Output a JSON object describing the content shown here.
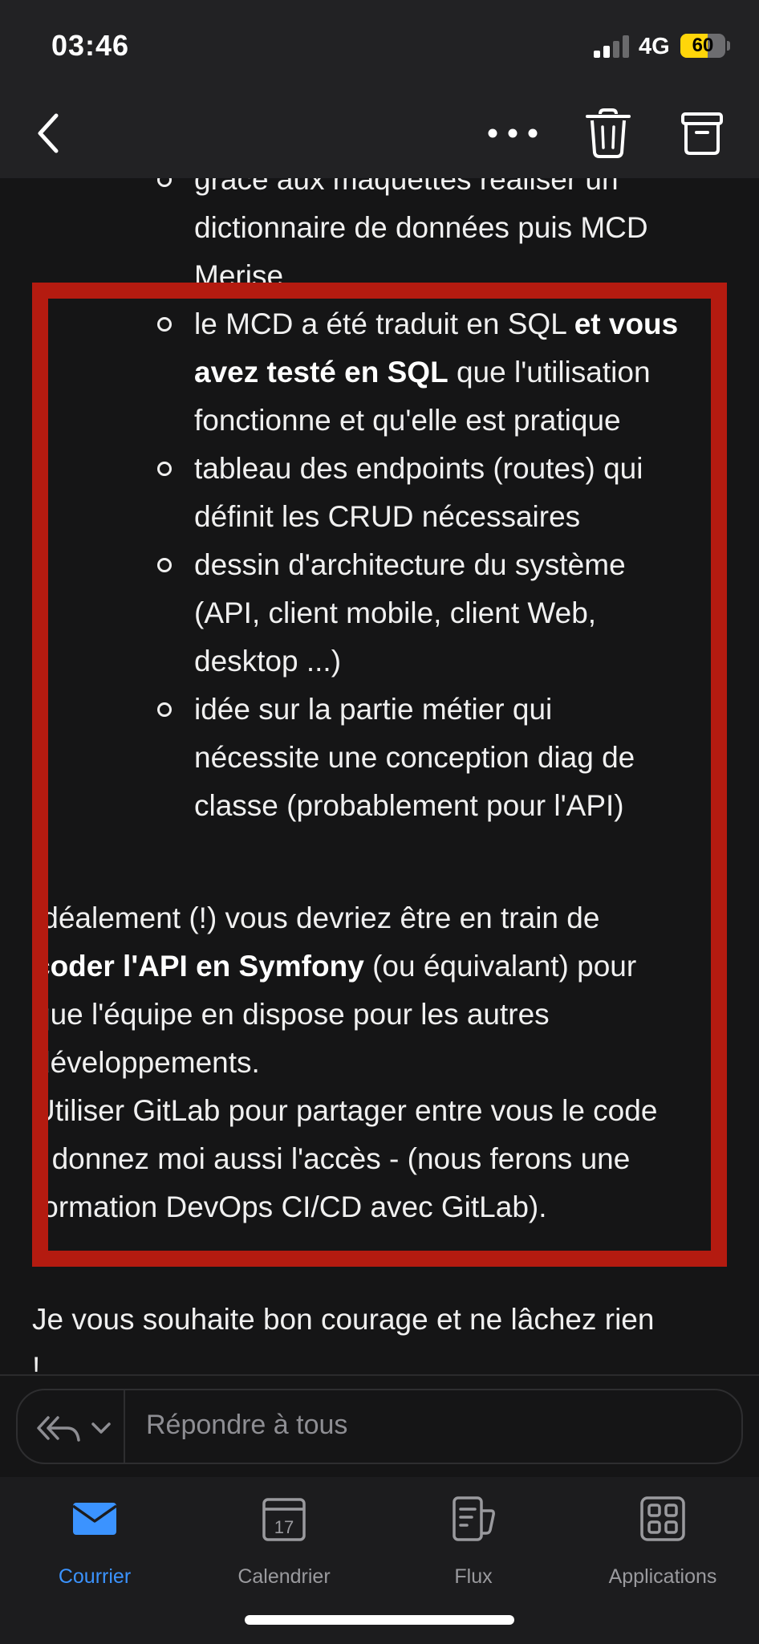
{
  "status": {
    "time": "03:46",
    "network": "4G",
    "battery": "60",
    "battery_level": 0.6
  },
  "email": {
    "lines": [
      {
        "bullet": true,
        "segments": [
          {
            "text": "grâce aux maquettes réaliser un",
            "bold": false
          }
        ]
      },
      {
        "bullet": false,
        "segments": [
          {
            "text": "dictionnaire de données puis MCD",
            "bold": false
          }
        ]
      },
      {
        "bullet": false,
        "segments": [
          {
            "text": "Merise",
            "bold": false
          }
        ]
      },
      {
        "bullet": true,
        "segments": [
          {
            "text": "le MCD a été traduit en SQL ",
            "bold": false
          },
          {
            "text": "et vous",
            "bold": true
          }
        ]
      },
      {
        "bullet": false,
        "segments": [
          {
            "text": "avez testé en SQL",
            "bold": true
          },
          {
            "text": " que l'utilisation",
            "bold": false
          }
        ]
      },
      {
        "bullet": false,
        "segments": [
          {
            "text": "fonctionne et qu'elle est pratique",
            "bold": false
          }
        ]
      },
      {
        "bullet": true,
        "segments": [
          {
            "text": "tableau des endpoints (routes) qui",
            "bold": false
          }
        ]
      },
      {
        "bullet": false,
        "segments": [
          {
            "text": "définit les CRUD nécessaires",
            "bold": false
          }
        ]
      },
      {
        "bullet": true,
        "segments": [
          {
            "text": "dessin d'architecture du système",
            "bold": false
          }
        ]
      },
      {
        "bullet": false,
        "segments": [
          {
            "text": "(API, client mobile, client Web,",
            "bold": false
          }
        ]
      },
      {
        "bullet": false,
        "segments": [
          {
            "text": "desktop ...)",
            "bold": false
          }
        ]
      },
      {
        "bullet": true,
        "segments": [
          {
            "text": "idée sur la partie métier qui",
            "bold": false
          }
        ]
      },
      {
        "bullet": false,
        "segments": [
          {
            "text": "nécessite une conception diag de",
            "bold": false
          }
        ]
      },
      {
        "bullet": false,
        "segments": [
          {
            "text": "classe (probablement pour l'API)",
            "bold": false
          }
        ]
      },
      {
        "bullet": false,
        "segments": [
          {
            "text": "Idéalement (!) vous devriez être en train de",
            "bold": false
          }
        ]
      },
      {
        "bullet": false,
        "segments": [
          {
            "text": "coder l'API en Symfony",
            "bold": true
          },
          {
            "text": " (ou équivalant) pour",
            "bold": false
          }
        ]
      },
      {
        "bullet": false,
        "segments": [
          {
            "text": "que l'équipe en dispose pour les autres",
            "bold": false
          }
        ]
      },
      {
        "bullet": false,
        "segments": [
          {
            "text": "développements.",
            "bold": false
          }
        ]
      },
      {
        "bullet": false,
        "segments": [
          {
            "text": "Utiliser GitLab pour partager entre vous le code",
            "bold": false
          }
        ]
      },
      {
        "bullet": false,
        "segments": [
          {
            "text": "- donnez moi aussi l'accès -  (nous ferons une",
            "bold": false
          }
        ]
      },
      {
        "bullet": false,
        "segments": [
          {
            "text": "formation DevOps CI/CD avec GitLab).",
            "bold": false
          }
        ]
      },
      {
        "bullet": false,
        "segments": [
          {
            "text": "Je vous souhaite bon courage et ne lâchez rien",
            "bold": false
          }
        ]
      },
      {
        "bullet": false,
        "segments": [
          {
            "text": "!",
            "bold": false
          }
        ]
      }
    ]
  },
  "reply": {
    "placeholder": "Répondre à tous"
  },
  "tabs": [
    {
      "label": "Courrier",
      "icon": "mail-icon",
      "active": true
    },
    {
      "label": "Calendrier",
      "icon": "calendar-icon",
      "day": "17",
      "active": false
    },
    {
      "label": "Flux",
      "icon": "feed-icon",
      "active": false
    },
    {
      "label": "Applications",
      "icon": "apps-grid-icon",
      "active": false
    }
  ],
  "colors": {
    "accent": "#3b93ff",
    "highlight_frame": "#b41b10",
    "battery": "#ffd60a"
  }
}
